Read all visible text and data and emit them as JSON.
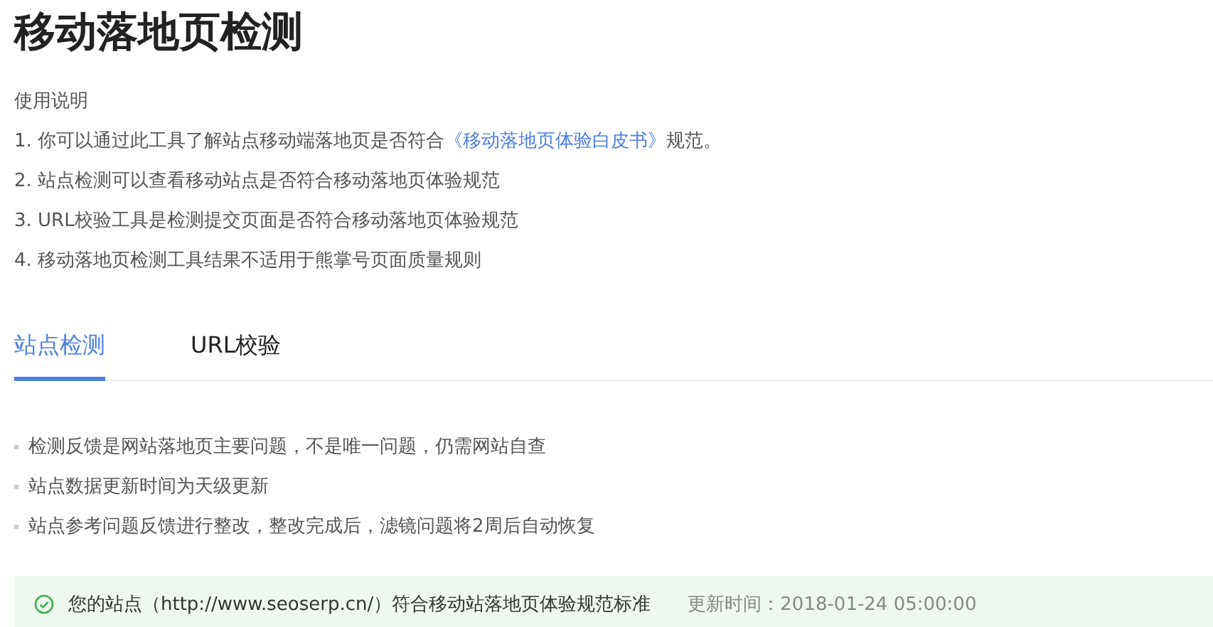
{
  "page": {
    "title": "移动落地页检测"
  },
  "instructions": {
    "heading": "使用说明",
    "items": [
      {
        "text": "1. 你可以通过此工具了解站点移动端落地页是否符合",
        "link": "《移动落地页体验白皮书》",
        "after": "规范。"
      },
      {
        "text": "2. 站点检测可以查看移动站点是否符合移动落地页体验规范"
      },
      {
        "text": "3. URL校验工具是检测提交页面是否符合移动落地页体验规范"
      },
      {
        "text": "4. 移动落地页检测工具结果不适用于熊掌号页面质量规则"
      }
    ]
  },
  "tabs": [
    {
      "label": "站点检测",
      "selected": true
    },
    {
      "label": "URL校验",
      "selected": false
    }
  ],
  "notes": [
    "检测反馈是网站落地页主要问题，不是唯一问题，仍需网站自查",
    "站点数据更新时间为天级更新",
    "站点参考问题反馈进行整改，整改完成后，滤镜问题将2周后自动恢复"
  ],
  "result": {
    "passed": true,
    "message": "您的站点（http://www.seoserp.cn/）符合移动站落地页体验规范标准",
    "updated": "更新时间：2018-01-24 05:00:00"
  }
}
